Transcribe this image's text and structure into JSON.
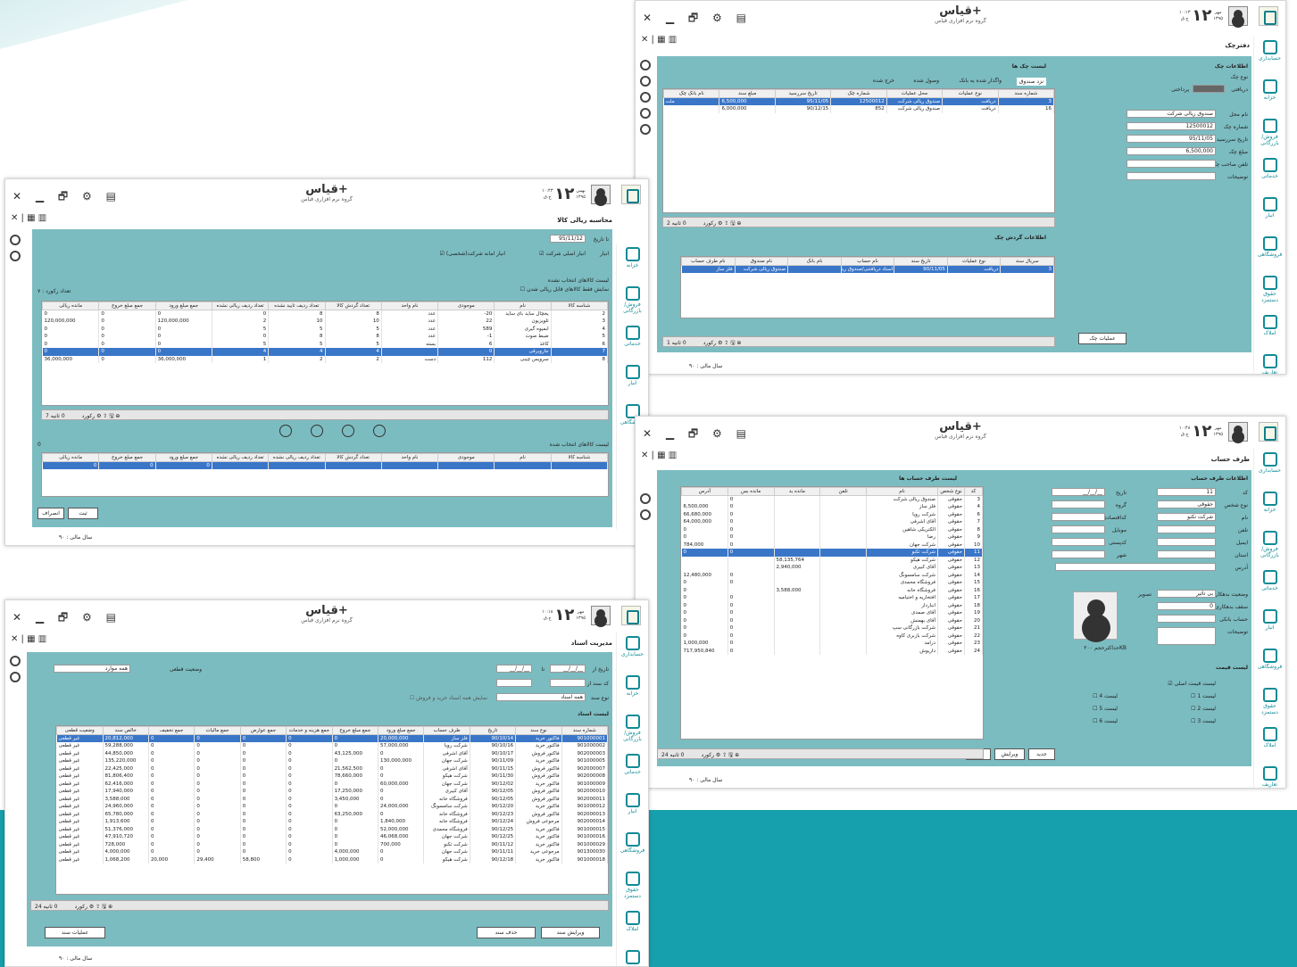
{
  "app": {
    "name": "قیاس+",
    "subtitle": "گروه نرم افزاری قیاس",
    "fiscal_year": "سال مالی : ۹۰",
    "win_controls": "✕ ▁ 🗗 ⚙ ▤",
    "toolbar": "✕ | ▦ ▥"
  },
  "sidebar": [
    "حسابداری",
    "خزانه",
    "فروش/بازرگانی",
    "خدماتی",
    "انبار",
    "فروشگاهی",
    "حقوق دستمزد",
    "املاک",
    "تعاریف عمومی"
  ],
  "w1": {
    "day": "۱۲",
    "month": "مهر",
    "year": "۱۳۹۵",
    "time": "۱۰:۱۳",
    "weekday": "ج.ق",
    "title": "دفترچک",
    "info_title": "اطلاعات چک",
    "list_title": "لیست چک ها",
    "flow_title": "اطلاعات گردش چک",
    "f_type": "نوع چک",
    "f_dir1": "دریافتی",
    "f_dir2": "پرداختی",
    "f_place": "نام محل",
    "v_place": "صندوق ریالی شرکت",
    "f_no": "شماره چک",
    "v_no": "12500012",
    "f_due": "تاریخ سررسید",
    "v_due": "95/11/05",
    "f_amt": "مبلغ چک",
    "v_amt": "6,500,000",
    "f_tel": "تلفن صاحب چک",
    "f_desc": "توضیحات",
    "tabs": [
      "نزد صندوق",
      "واگذار شده به بانک",
      "وصول شده",
      "خرج شده"
    ],
    "cols": [
      "شماره سند",
      "نوع عملیات",
      "محل عملیات",
      "شماره چک",
      "تاریخ سررسید",
      "مبلغ سند",
      "نام بانک چک"
    ],
    "rows": [
      [
        "3",
        "دریافت",
        "صندوق ریالی شرکت",
        "12500012",
        "95/11/05",
        "6,500,000",
        "ملت"
      ],
      [
        "16",
        "دریافت",
        "صندوق ریالی شرکت",
        "852",
        "90/12/15",
        "6,000,000",
        ""
      ]
    ],
    "foot": "2 رکورد",
    "foot2": "0 ثانیه",
    "ops": "عملیات چک",
    "fcols": [
      "سریال سند",
      "نوع عملیات",
      "تاریخ سند",
      "نام حساب",
      "نام بانک",
      "نام صندوق",
      "نام طرف حساب"
    ],
    "frows": [
      [
        "3",
        "دریافت",
        "90/11/05",
        "اسناد دریافتنی/صندوق ریالی شرکت",
        "",
        "صندوق ریالی شرکت",
        "فلز ساز"
      ]
    ],
    "ffoot": "1 رکورد"
  },
  "w2": {
    "day": "۱۲",
    "month": "بهمن",
    "year": "۱۳۹۵",
    "time": "۱۰:۴۳",
    "weekday": "ج.ق",
    "title": "محاسبه ریالی کالا",
    "f_todate": "تا تاریخ",
    "v_todate": "95/11/12",
    "f_store": "انبار",
    "c1": "انبار اصلی شرکت",
    "c2": "انبار امانه شرکت(شخصی)",
    "list1": "لیست کالاهای انتخاب نشده",
    "chk": "نمایش فقط کالاهای قابل ریالی شدن",
    "count": "تعداد رکورد : ۷",
    "cols": [
      "شناسه کالا",
      "نام",
      "موجودی",
      "نام واحد",
      "تعداد گردش کالا",
      "تعداد ردیف تایید نشده",
      "تعداد ردیف ریالی نشده",
      "جمع مبلغ ورود",
      "جمع مبلغ خروج",
      "مانده ریالی"
    ],
    "rows": [
      [
        "2",
        "یخچال ساید بای ساید",
        "20-",
        "عدد",
        "8",
        "8",
        "0",
        "0",
        "0",
        "0"
      ],
      [
        "3",
        "تلویزیون",
        "22",
        "عدد",
        "10",
        "10",
        "2",
        "120,000,000",
        "0",
        "120,000,000"
      ],
      [
        "4",
        "ابمیوه گیری",
        "589",
        "عدد",
        "5",
        "5",
        "5",
        "0",
        "0",
        "0"
      ],
      [
        "5",
        "ضبط صوت",
        "1-",
        "عدد",
        "8",
        "8",
        "0",
        "0",
        "0",
        "0"
      ],
      [
        "6",
        "کاغذ",
        "6",
        "بسته",
        "5",
        "5",
        "5",
        "0",
        "0",
        "0"
      ],
      [
        "7",
        "جاروبرقی",
        "0",
        "",
        "4",
        "4",
        "4",
        "0",
        "0",
        "0"
      ],
      [
        "8",
        "سرویس چینی",
        "112",
        "دست",
        "2",
        "2",
        "1",
        "36,000,000",
        "0",
        "36,000,000"
      ]
    ],
    "foot": "7 رکورد",
    "foot2": "0 ثانیه",
    "list2": "لیست کالاهای انتخاب شده",
    "zero": "0",
    "cols2": [
      "شناسه کالا",
      "نام",
      "موجودی",
      "نام واحد",
      "تعداد گردش کالا",
      "تعداد ردیف ریالی نشده",
      "تعداد ردیف ریالی نشده",
      "جمع مبلغ ورود",
      "جمع مبلغ خروج",
      "مانده ریالی"
    ],
    "row2": [
      "",
      "",
      "",
      "",
      "",
      "",
      "",
      "0",
      "0",
      "0"
    ],
    "ok": "ثبت",
    "cancel": "انصراف"
  },
  "w3": {
    "day": "۱۲",
    "month": "مهر",
    "year": "۱۳۹۵",
    "time": "۱۰:۴۸",
    "weekday": "ج.ق",
    "title": "طرف حساب",
    "info": "اطلاعات طرف حساب",
    "list": "لیست طرف حساب ها",
    "labels": [
      "کد",
      "نوع شخص",
      "نام",
      "تلفن",
      "ایمیل",
      "استان",
      "آدرس",
      "وضعیت بدهکاری",
      "سقف بدهکاری",
      "حساب بانکی",
      "توضیحات"
    ],
    "v_code": "11",
    "v_type": "حقوقی",
    "v_name": "شرکت تکنو",
    "v_status": "بی تاثیر",
    "v_limit": "0",
    "l2": [
      "تاریخ",
      "گروه",
      "کداقتصادی",
      "موبایل",
      "کدپستی",
      "شهر",
      "تصویر"
    ],
    "v_date": "__/__/__",
    "photo_size": "حداکثرحجم ۲۰۰KB",
    "price": "لیست قیمت",
    "prices": [
      "لیست قیمت اصلی",
      "لیست 1",
      "لیست 2",
      "لیست 3",
      "لیست 4",
      "لیست 5",
      "لیست 6"
    ],
    "cols": [
      "کد",
      "نوع شخص",
      "نام",
      "تلفن",
      "مانده بد",
      "مانده بس",
      "آدرس"
    ],
    "rows": [
      [
        "3",
        "حقوقی",
        "صندوق ریالی شرکت",
        "",
        "",
        "0",
        ""
      ],
      [
        "4",
        "حقوقی",
        "فلز ساز",
        "",
        "",
        "0",
        "6,500,000"
      ],
      [
        "6",
        "حقوقی",
        "شرکت رویا",
        "",
        "",
        "0",
        "66,680,000"
      ],
      [
        "7",
        "حقوقی",
        "آقای اشرفی",
        "",
        "",
        "0",
        "64,000,000"
      ],
      [
        "8",
        "حقوقی",
        "الکتریکی شاهین",
        "",
        "",
        "0",
        "0"
      ],
      [
        "9",
        "حقوقی",
        "رضا",
        "",
        "",
        "0",
        "0"
      ],
      [
        "10",
        "حقوقی",
        "شرکت جهان",
        "",
        "",
        "0",
        "784,000"
      ],
      [
        "11",
        "حقوقی",
        "شرکت تکنو",
        "",
        "",
        "0",
        "0"
      ],
      [
        "12",
        "حقوقی",
        "شرکت هیکو",
        "",
        "58,135,764",
        "",
        ""
      ],
      [
        "13",
        "حقوقی",
        "آقای کبیری",
        "",
        "2,940,000",
        "",
        ""
      ],
      [
        "14",
        "حقوقی",
        "شرکت سامسونگ",
        "",
        "",
        "0",
        "12,480,000"
      ],
      [
        "15",
        "حقوقی",
        "فروشگاه محمدی",
        "",
        "",
        "0",
        "0"
      ],
      [
        "16",
        "حقوقی",
        "فروشگاه خانه",
        "",
        "3,588,000",
        "",
        "0"
      ],
      [
        "17",
        "حقوقی",
        "افتخاریه و اختیامیه",
        "",
        "",
        "0",
        "0"
      ],
      [
        "18",
        "حقوقی",
        "انباردار",
        "",
        "",
        "0",
        "0"
      ],
      [
        "19",
        "حقوقی",
        "آقای صمدی",
        "",
        "",
        "0",
        "0"
      ],
      [
        "20",
        "حقوقی",
        "آقای بهمنش",
        "",
        "",
        "0",
        "0"
      ],
      [
        "21",
        "حقوقی",
        "شرکت بازرگانی سپ",
        "",
        "",
        "0",
        "0"
      ],
      [
        "22",
        "حقوقی",
        "شرکت بازبری کاوه",
        "",
        "",
        "0",
        "0"
      ],
      [
        "23",
        "حقوقی",
        "درامد",
        "",
        "",
        "0",
        "1,000,000"
      ],
      [
        "24",
        "حقوقی",
        "داریوش",
        "",
        "",
        "0",
        "717,950,840"
      ]
    ],
    "foot": "24 رکورد",
    "foot2": "0 ثانیه",
    "b_new": "جدید",
    "b_edit": "ویرایش",
    "b_del": "حذف"
  },
  "w4": {
    "day": "۱۲",
    "month": "مهر",
    "year": "۱۳۹۵",
    "time": "۱۰:۱۸",
    "weekday": "ج.ق",
    "title": "مدیریت اسناد",
    "f_from": "تاریخ از",
    "f_to": "تا",
    "f_code": "کد سند از",
    "f_type": "نوع سند",
    "v_type": "همه اسناد",
    "f_status": "وضعیت قطعی",
    "v_status": "همه موارد",
    "chk": "نمایش همه اسناد خرید و فروش",
    "list": "لیست اسناد",
    "cols": [
      "شماره سند",
      "نوع سند",
      "تاریخ",
      "طرف حساب",
      "جمع مبلغ ورود",
      "جمع مبلغ خروج",
      "جمع هزینه و خدمات",
      "جمع عوارض",
      "جمع مالیات",
      "جمع تخفیف",
      "خالص سند",
      "وضعیت قطعی"
    ],
    "rows": [
      [
        "901000001",
        "فاکتور خرید",
        "90/10/14",
        "فلز ساز",
        "20,000,000",
        "0",
        "0",
        "0",
        "0",
        "0",
        "20,812,000",
        "غیر قطعی"
      ],
      [
        "901000002",
        "فاکتور خرید",
        "90/10/16",
        "شرکت رویا",
        "57,000,000",
        "0",
        "0",
        "0",
        "0",
        "0",
        "59,288,000",
        "غیر قطعی"
      ],
      [
        "902000003",
        "فاکتور فروش",
        "90/10/17",
        "آقای اشرفی",
        "0",
        "43,125,000",
        "0",
        "0",
        "0",
        "0",
        "44,850,000",
        "غیر قطعی"
      ],
      [
        "901000005",
        "فاکتور خرید",
        "90/11/09",
        "شرکت جهان",
        "130,000,000",
        "0",
        "0",
        "0",
        "0",
        "0",
        "135,220,000",
        "غیر قطعی"
      ],
      [
        "902000007",
        "فاکتور فروش",
        "90/11/15",
        "آقای اشرفی",
        "0",
        "21,562,500",
        "0",
        "0",
        "0",
        "0",
        "22,425,000",
        "غیر قطعی"
      ],
      [
        "902000008",
        "فاکتور فروش",
        "90/11/30",
        "شرکت هیکو",
        "0",
        "78,660,000",
        "0",
        "0",
        "0",
        "0",
        "81,806,400",
        "غیر قطعی"
      ],
      [
        "901000009",
        "فاکتور خرید",
        "90/12/02",
        "شرکت جهان",
        "60,000,000",
        "0",
        "0",
        "0",
        "0",
        "0",
        "62,416,000",
        "غیر قطعی"
      ],
      [
        "902000010",
        "فاکتور فروش",
        "90/12/05",
        "آقای کبیری",
        "0",
        "17,250,000",
        "0",
        "0",
        "0",
        "0",
        "17,940,000",
        "غیر قطعی"
      ],
      [
        "902000011",
        "فاکتور فروش",
        "90/12/05",
        "فروشگاه خانه",
        "0",
        "3,450,000",
        "0",
        "0",
        "0",
        "0",
        "3,588,000",
        "غیر قطعی"
      ],
      [
        "901000012",
        "فاکتور خرید",
        "90/12/20",
        "شرکت سامسونگ",
        "24,000,000",
        "0",
        "0",
        "0",
        "0",
        "0",
        "24,960,000",
        "غیر قطعی"
      ],
      [
        "902000013",
        "فاکتور فروش",
        "90/12/23",
        "فروشگاه خانه",
        "0",
        "63,250,000",
        "0",
        "0",
        "0",
        "0",
        "65,780,000",
        "غیر قطعی"
      ],
      [
        "902000014",
        "مرجوعی فروش",
        "90/12/24",
        "فروشگاه خانه",
        "1,840,000",
        "0",
        "0",
        "0",
        "0",
        "0",
        "1,913,600",
        "غیر قطعی"
      ],
      [
        "901000015",
        "فاکتور خرید",
        "90/12/25",
        "فروشگاه محمدی",
        "52,000,000",
        "0",
        "0",
        "0",
        "0",
        "0",
        "51,376,000",
        "غیر قطعی"
      ],
      [
        "901000016",
        "فاکتور خرید",
        "90/12/25",
        "شرکت جهان",
        "46,068,000",
        "0",
        "0",
        "0",
        "0",
        "0",
        "47,910,720",
        "غیر قطعی"
      ],
      [
        "901000029",
        "فاکتور خرید",
        "90/11/12",
        "شرکت تکنو",
        "700,000",
        "0",
        "0",
        "0",
        "0",
        "0",
        "728,000",
        "غیر قطعی"
      ],
      [
        "901300030",
        "مرجوعی خرید",
        "90/11/11",
        "شرکت جهان",
        "0",
        "4,000,000",
        "0",
        "0",
        "0",
        "0",
        "4,000,000",
        "غیر قطعی"
      ],
      [
        "901000018",
        "فاکتور خرید",
        "90/12/18",
        "شرکت هیکو",
        "0",
        "1,000,000",
        "0",
        "58,800",
        "29,400",
        "20,000",
        "1,068,200",
        "غیر قطعی"
      ]
    ],
    "foot": "24 رکورد",
    "foot2": "0 ثانیه",
    "b_edit": "ویرایش سند",
    "b_del": "حذف سند",
    "ops": "عملیات سند"
  }
}
